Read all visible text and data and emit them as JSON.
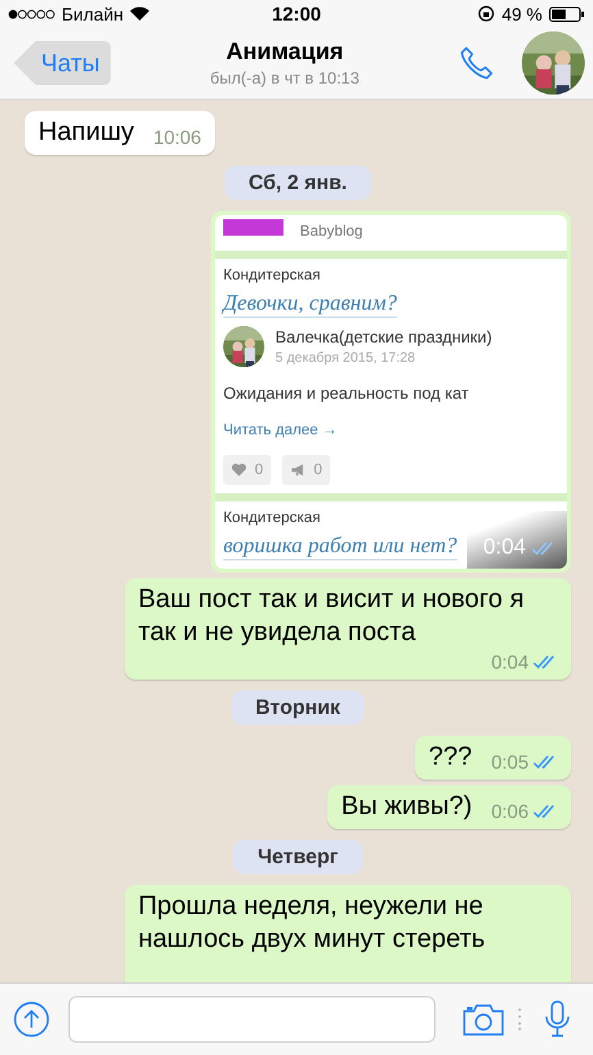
{
  "status_bar": {
    "carrier": "Билайн",
    "time": "12:00",
    "battery": "49 %"
  },
  "header": {
    "back": "Чаты",
    "title": "Анимация",
    "subtitle": "был(-а) в чт в 10:13"
  },
  "messages": [
    {
      "kind": "text",
      "outgoing": false,
      "text": "Напишу",
      "time": "10:06"
    },
    {
      "kind": "date",
      "text": "Сб, 2 янв."
    },
    {
      "outgoing": true,
      "time": "0:04",
      "read": true,
      "screenshot": {
        "site": "Babyblog",
        "posts": [
          {
            "category": "Кондитерская",
            "title": "Девочки, сравним?",
            "author": "Валечка(детские праздники)",
            "date": "5 декабря 2015, 17:28",
            "excerpt": "Ожидания и реальность под кат",
            "more": "Читать далее →",
            "likes": "0",
            "shares": "0"
          },
          {
            "category": "Кондитерская",
            "title": "воришка работ или нет?"
          }
        ]
      }
    },
    {
      "kind": "text",
      "outgoing": true,
      "text": "Ваш пост так и висит и нового я так и не увидела поста",
      "time": "0:04",
      "read": true
    },
    {
      "kind": "date",
      "text": "Вторник"
    },
    {
      "kind": "text",
      "outgoing": true,
      "text": "???",
      "time": "0:05",
      "read": true
    },
    {
      "kind": "text",
      "outgoing": true,
      "text": "Вы живы?)",
      "time": "0:06",
      "read": true
    },
    {
      "kind": "date",
      "text": "Четверг"
    },
    {
      "kind": "text",
      "outgoing": true,
      "text": "Прошла неделя, неужели не нашлось двух минут стереть"
    }
  ]
}
